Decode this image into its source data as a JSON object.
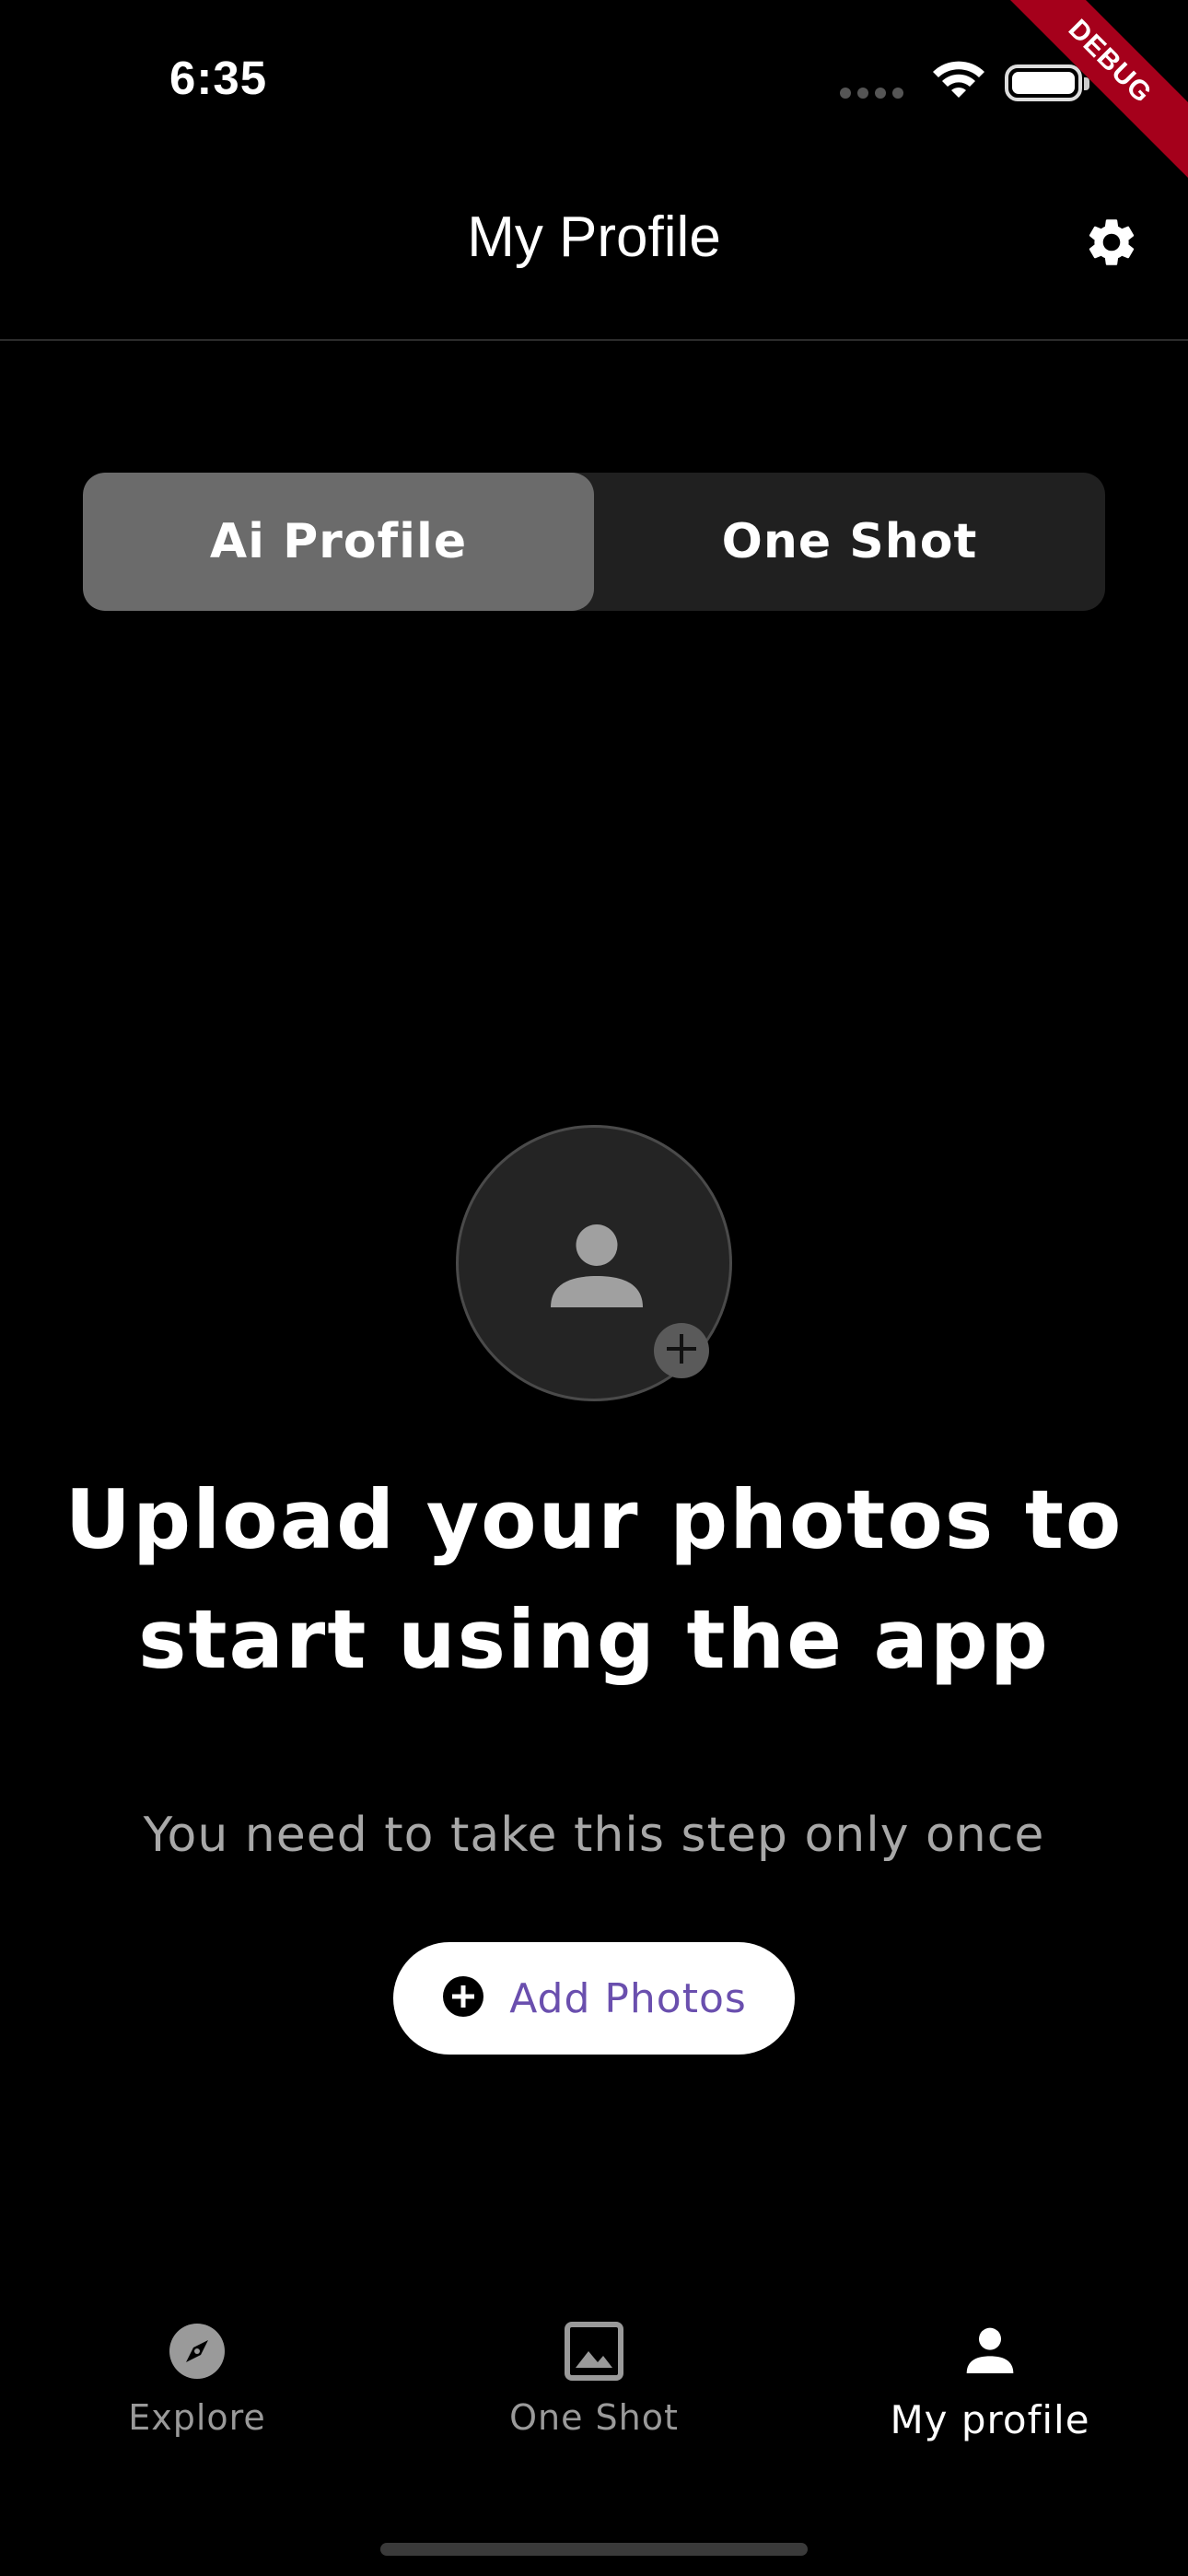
{
  "status_bar": {
    "time": "6:35"
  },
  "debug_banner": "DEBUG",
  "header": {
    "title": "My Profile"
  },
  "tabs": [
    {
      "label": "Ai Profile",
      "selected": true
    },
    {
      "label": "One Shot",
      "selected": false
    }
  ],
  "empty_state": {
    "headline_line1": "Upload your photos to",
    "headline_line2": "start using the app",
    "subtitle": "You need to take this step only once",
    "button_label": "Add Photos"
  },
  "bottom_nav": {
    "items": [
      {
        "label": "Explore",
        "icon": "compass-icon",
        "active": false
      },
      {
        "label": "One Shot",
        "icon": "image-icon",
        "active": false
      },
      {
        "label": "My profile",
        "icon": "person-icon",
        "active": true
      }
    ]
  },
  "colors": {
    "background": "#000000",
    "segment_active": "#6b6b6b",
    "segment_bg": "#202020",
    "button_text": "#6a4fae",
    "debug_ribbon": "#a5001b"
  }
}
